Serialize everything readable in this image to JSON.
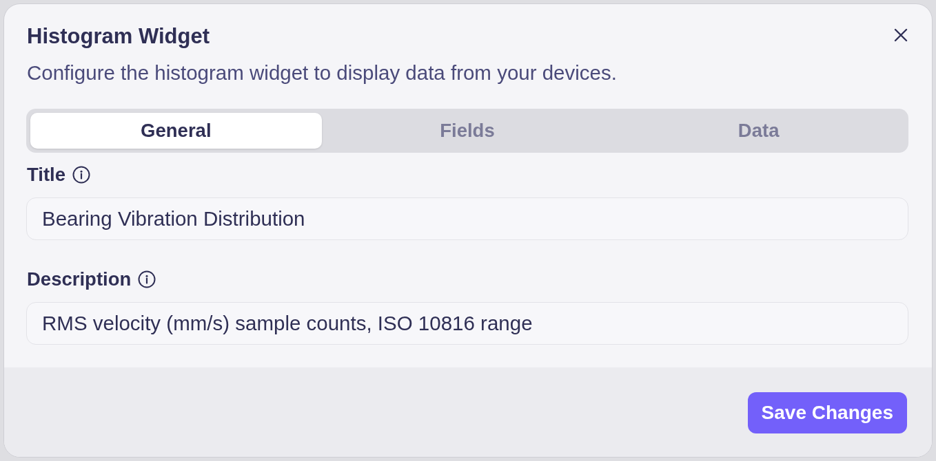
{
  "dialog": {
    "title": "Histogram Widget",
    "subtitle": "Configure the histogram widget to display data from your devices."
  },
  "tabs": [
    {
      "label": "General",
      "selected": true
    },
    {
      "label": "Fields",
      "selected": false
    },
    {
      "label": "Data",
      "selected": false
    }
  ],
  "fields": [
    {
      "label": "Title",
      "value": "Bearing Vibration Distribution"
    },
    {
      "label": "Description",
      "value": "RMS velocity (mm/s) sample counts, ISO 10816 range"
    }
  ],
  "footer": {
    "primary_button": "Save Changes"
  }
}
